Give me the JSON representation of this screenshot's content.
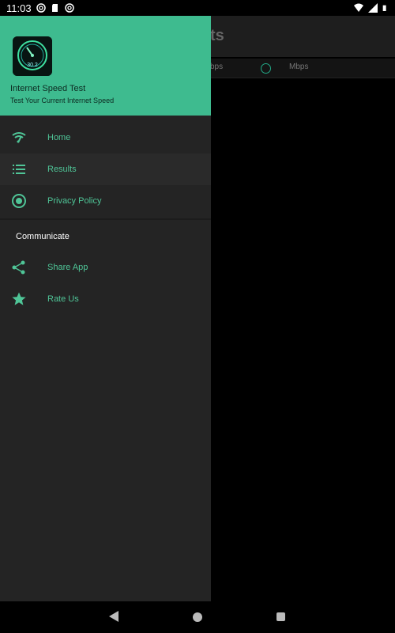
{
  "status_bar": {
    "time": "11:03"
  },
  "background_app": {
    "title_fragment": "ts",
    "unit_left": "bps",
    "unit_right": "Mbps"
  },
  "drawer": {
    "header": {
      "app_title": "Internet Speed Test",
      "app_subtitle": "Test Your Current Internet Speed",
      "logo_value": "30.2"
    },
    "items": [
      {
        "label": "Home",
        "icon": "wifi-icon"
      },
      {
        "label": "Results",
        "icon": "list-icon"
      },
      {
        "label": "Privacy Policy",
        "icon": "radio-icon"
      }
    ],
    "section_title": "Communicate",
    "communicate_items": [
      {
        "label": "Share App",
        "icon": "share-icon"
      },
      {
        "label": "Rate Us",
        "icon": "star-icon"
      }
    ]
  },
  "colors": {
    "accent": "#3ebb8f",
    "menu_text": "#4fc597",
    "drawer_bg": "#242424"
  }
}
